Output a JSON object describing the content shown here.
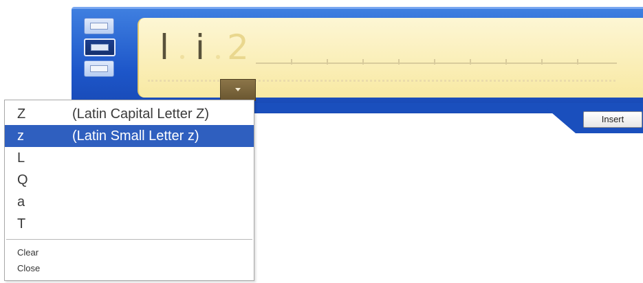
{
  "window": {
    "colors": {
      "frame_blue": "#1d56c9",
      "writing_area_yellow": "#f8e9a3",
      "highlight_blue": "#2f5fbf"
    }
  },
  "sidebar": {
    "buttons": [
      {
        "icon": "writing-pad-icon",
        "selected": false
      },
      {
        "icon": "character-pad-icon",
        "selected": true
      },
      {
        "icon": "keyboard-icon",
        "selected": false
      }
    ]
  },
  "writing_area": {
    "characters": [
      {
        "text": "l",
        "state": "recognized"
      },
      {
        "text": "i",
        "state": "recognized"
      },
      {
        "text": "2",
        "state": "pending"
      }
    ],
    "dropdown_icon": "chevron-down-icon"
  },
  "toolbar": {
    "insert_label": "Insert"
  },
  "menu": {
    "items": [
      {
        "char": "Z",
        "desc": "(Latin Capital Letter Z)",
        "highlighted": false
      },
      {
        "char": "z",
        "desc": "(Latin Small Letter z)",
        "highlighted": true
      },
      {
        "char": "L",
        "desc": "",
        "highlighted": false
      },
      {
        "char": "Q",
        "desc": "",
        "highlighted": false
      },
      {
        "char": "a",
        "desc": "",
        "highlighted": false
      },
      {
        "char": "T",
        "desc": "",
        "highlighted": false
      }
    ],
    "commands": {
      "clear_label": "Clear",
      "close_label": "Close"
    }
  }
}
